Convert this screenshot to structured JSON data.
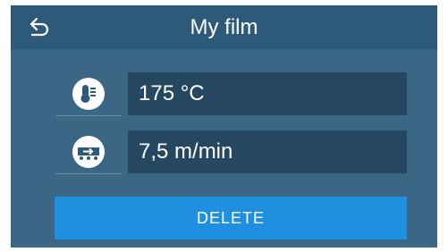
{
  "header": {
    "title": "My film",
    "back_icon": "back-arrow-icon"
  },
  "fields": [
    {
      "icon": "thermometer-icon",
      "value": "175 °C"
    },
    {
      "icon": "conveyor-speed-icon",
      "value": "7,5 m/min"
    }
  ],
  "actions": {
    "delete_label": "DELETE"
  },
  "colors": {
    "screen_bg": "#3b6684",
    "header_bg": "#2d5a78",
    "field_bg": "#254760",
    "accent": "#1f8fe0"
  }
}
